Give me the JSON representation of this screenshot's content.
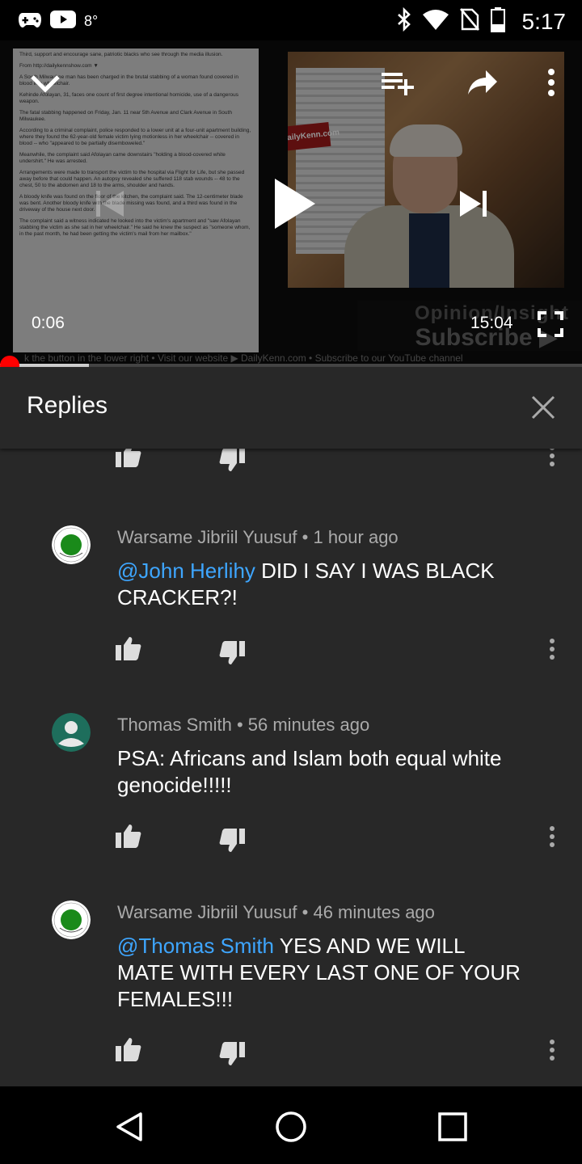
{
  "status_bar": {
    "temperature": "8°",
    "time": "5:17",
    "icons": [
      "gamepad-icon",
      "youtube-icon",
      "bluetooth-icon",
      "wifi-icon",
      "no-sim-icon",
      "battery-icon"
    ]
  },
  "player": {
    "current_time": "0:06",
    "total_time": "15:04",
    "progress": 0.0066,
    "article_lines": [
      "Third, support and encourage sane, patriotic blacks who see through the media illusion.",
      "From http://dailykennshow.com ▼",
      "A South Milwaukee man has been charged in the brutal stabbing of a woman found covered in blood in a wheelchair.",
      "Kehinde Afolayan, 31, faces one count of first degree intentional homicide, use of a dangerous weapon.",
      "The fatal stabbing happened on Friday, Jan. 11 near 5th Avenue and Clark Avenue in South Milwaukee.",
      "According to a criminal complaint, police responded to a lower unit at a four-unit apartment building, where they found the 62-year-old female victim lying motionless in her wheelchair -- covered in blood -- who \"appeared to be partially disemboweled.\"",
      "Meanwhile, the complaint said Afolayan came downstairs \"holding a blood-covered white undershirt.\" He was arrested.",
      "Arrangements were made to transport the victim to the hospital via Flight for Life, but she passed away before that could happen. An autopsy revealed she suffered 118 stab wounds -- 48 to the chest, 50 to the abdomen and 18 to the arms, shoulder and hands.",
      "A bloody knife was found on the floor of the kitchen, the complaint said. The 12-centimeter blade was bent. Another bloody knife with the blade missing was found, and a third was found in the driveway of the house next door.",
      "The complaint said a witness indicated he looked into the victim's apartment and \"saw Afolayan stabbing the victim as she sat in her wheelchair.\" He said he knew the suspect as \"someone whom, in the past month, he had been getting the victim's mail from her mailbox.\""
    ],
    "webcam_sign": "DailyKenn.com",
    "overlay_line1": "Opinion/Insight",
    "overlay_line2": "Subscribe ▶",
    "ticker": "k the button in the lower right   •   Visit our website ▶ DailyKenn.com   •   Subscribe to our YouTube channel"
  },
  "replies": {
    "title": "Replies",
    "comments": [
      {
        "author": "Warsame Jibriil Yuusuf",
        "time": "1 hour ago",
        "mention": "@John Herlihy",
        "text": " DID I SAY I WAS BLACK CRACKER?!",
        "avatar": "green-seal"
      },
      {
        "author": "Thomas Smith",
        "time": "56 minutes ago",
        "mention": "",
        "text": "PSA: Africans and Islam both equal white genocide!!!!!",
        "avatar": "default-person"
      },
      {
        "author": "Warsame Jibriil Yuusuf",
        "time": "46 minutes ago",
        "mention": "@Thomas Smith",
        "text": " YES AND WE WILL MATE WITH EVERY LAST ONE OF YOUR FEMALES!!!",
        "avatar": "green-seal"
      }
    ]
  },
  "colors": {
    "background": "#282828",
    "mention": "#3ea6ff",
    "progress": "#ff0000",
    "avatar_teal": "#1e6e5c"
  }
}
